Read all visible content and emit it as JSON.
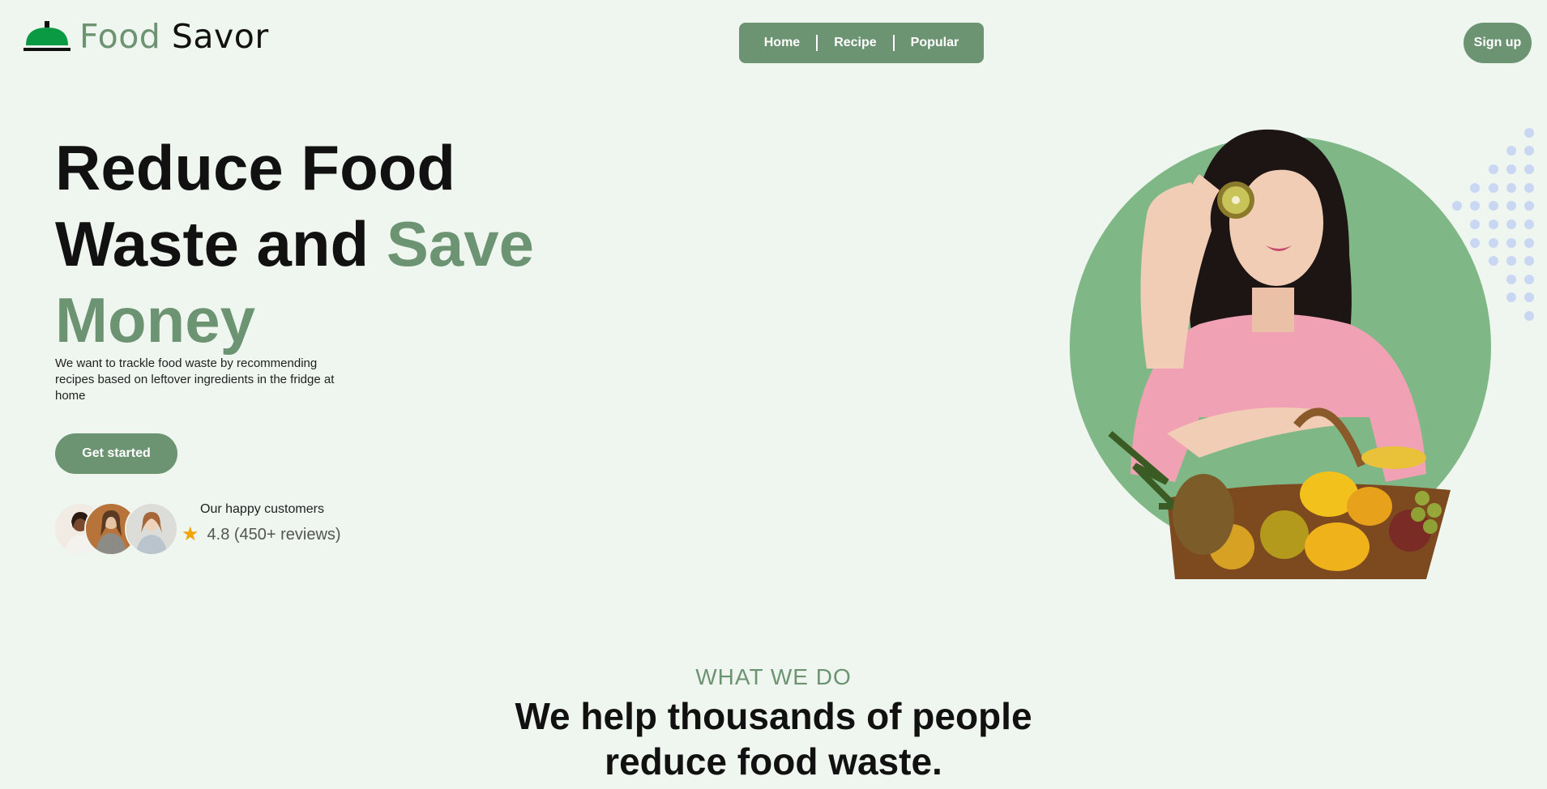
{
  "brand": {
    "name_part1": "Food",
    "name_part2": "Savor",
    "icon": "cloche-icon",
    "icon_color": "#0a9a44"
  },
  "nav": {
    "items": [
      "Home",
      "Recipe",
      "Popular"
    ],
    "bg_color": "#6d9472"
  },
  "header": {
    "signup_label": "Sign up"
  },
  "hero": {
    "headline_line1": "Reduce Food",
    "headline_line2_a": "Waste and ",
    "headline_line2_b": "Save",
    "headline_line3": "Money",
    "description": "We want to trackle food waste by recommending recipes based on leftover ingredients in the fridge at home",
    "cta_label": "Get started",
    "image": "woman-with-fruit-basket",
    "circle_color": "#80b787"
  },
  "customers": {
    "label": "Our happy customers",
    "rating": "4.8 (450+ reviews)",
    "star_icon": "star-icon",
    "star_color": "#f5a300"
  },
  "section": {
    "kicker": "WHAT WE DO",
    "title_line1": "We help thousands of people",
    "title_line2": "reduce food waste."
  },
  "colors": {
    "background": "#eff5ef",
    "accent": "#6d9472",
    "dots": "#c9d7f2"
  }
}
